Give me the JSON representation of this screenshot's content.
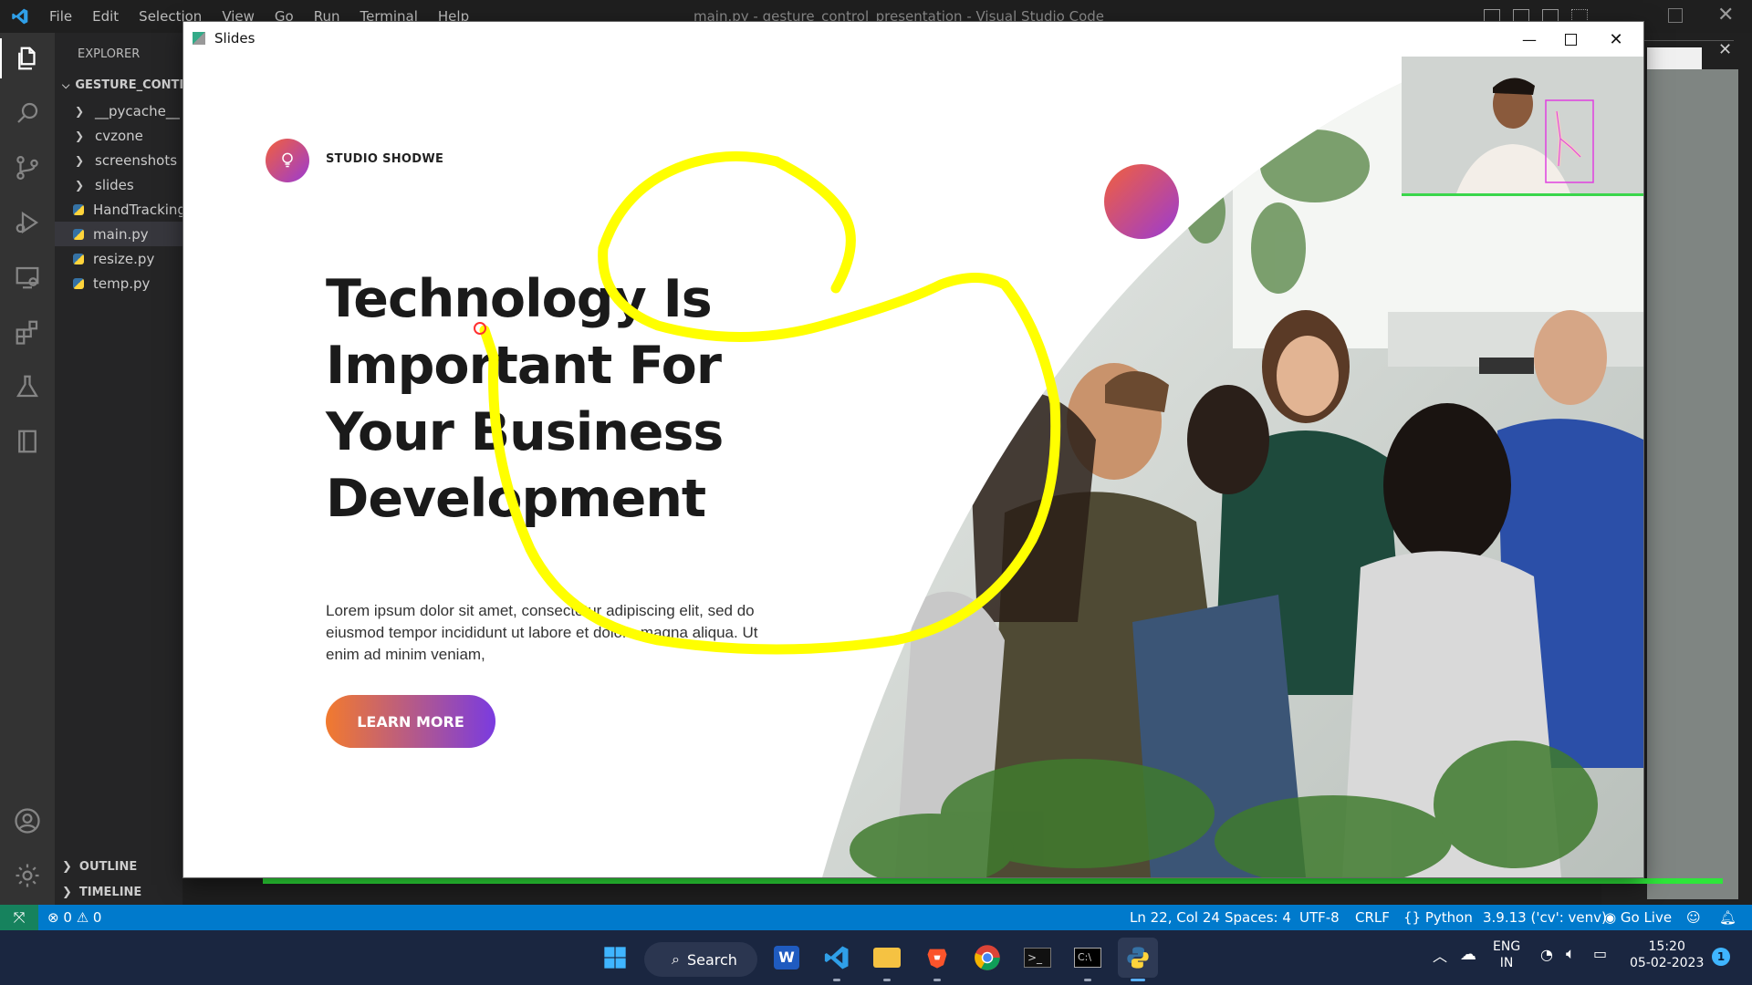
{
  "vscode": {
    "menu": [
      "File",
      "Edit",
      "Selection",
      "View",
      "Go",
      "Run",
      "Terminal",
      "Help"
    ],
    "window_title": "main.py - gesture_control_presentation - Visual Studio Code",
    "explorer_label": "EXPLORER",
    "project_name": "GESTURE_CONTRO",
    "tree": [
      {
        "label": "__pycache__",
        "kind": "folder"
      },
      {
        "label": "cvzone",
        "kind": "folder"
      },
      {
        "label": "screenshots",
        "kind": "folder"
      },
      {
        "label": "slides",
        "kind": "folder"
      },
      {
        "label": "HandTracking",
        "kind": "python"
      },
      {
        "label": "main.py",
        "kind": "python",
        "selected": true
      },
      {
        "label": "resize.py",
        "kind": "python"
      },
      {
        "label": "temp.py",
        "kind": "python"
      }
    ],
    "outline_label": "OUTLINE",
    "timeline_label": "TIMELINE",
    "status": {
      "errors": "0",
      "warnings": "0",
      "position": "Ln 22, Col 24",
      "spaces": "Spaces: 4",
      "encoding": "UTF-8",
      "eol": "CRLF",
      "language": "Python",
      "interpreter": "3.9.13 ('cv': venv)",
      "go_live": "Go Live"
    },
    "colors": {
      "status_bar": "#007acc",
      "remote": "#16825d"
    }
  },
  "slides_window": {
    "title": "Slides",
    "brand": "STUDIO SHODWE",
    "headline": [
      "Technology Is",
      "Important For",
      "Your Business",
      "Development"
    ],
    "body": "Lorem ipsum dolor sit amet, consectetur adipiscing elit, sed do eiusmod tempor incididunt ut labore et dolore magna aliqua. Ut enim ad minim veniam,",
    "cta": "LEARN MORE",
    "annotation_color": "#ffff00",
    "accent_gradient": [
      "#f2603c",
      "#9a3bd3"
    ]
  },
  "taskbar": {
    "search_label": "Search",
    "language": "ENG",
    "region": "IN",
    "time": "15:20",
    "date": "05-02-2023",
    "notification_count": "1"
  }
}
